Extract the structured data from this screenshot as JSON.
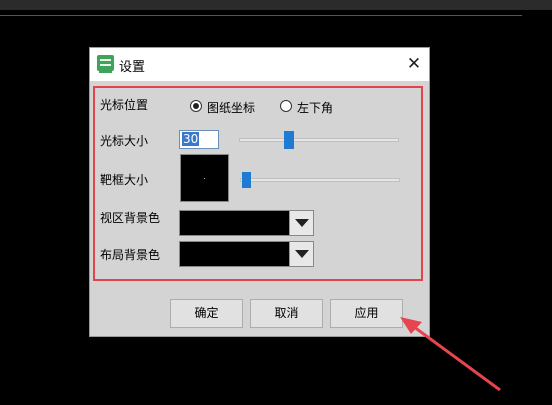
{
  "dialog": {
    "title": "设置",
    "close": "✕"
  },
  "cursor_position": {
    "label": "光标位置",
    "options": [
      "图纸坐标",
      "左下角"
    ],
    "selected": "图纸坐标"
  },
  "cursor_size": {
    "label": "光标大小",
    "value": "30",
    "slider_fraction": 0.22
  },
  "target_box_size": {
    "label": "靶框大小",
    "slider_fraction": 0.02
  },
  "viewport_background": {
    "label": "视区背景色",
    "value_color": "#000000"
  },
  "layout_background": {
    "label": "布局背景色",
    "value_color": "#000000"
  },
  "buttons": {
    "ok": "确定",
    "cancel": "取消",
    "apply": "应用"
  },
  "colors": {
    "highlight_border": "#e0444e",
    "slider_accent": "#1e7ad3",
    "arrow": "#e8444f"
  }
}
